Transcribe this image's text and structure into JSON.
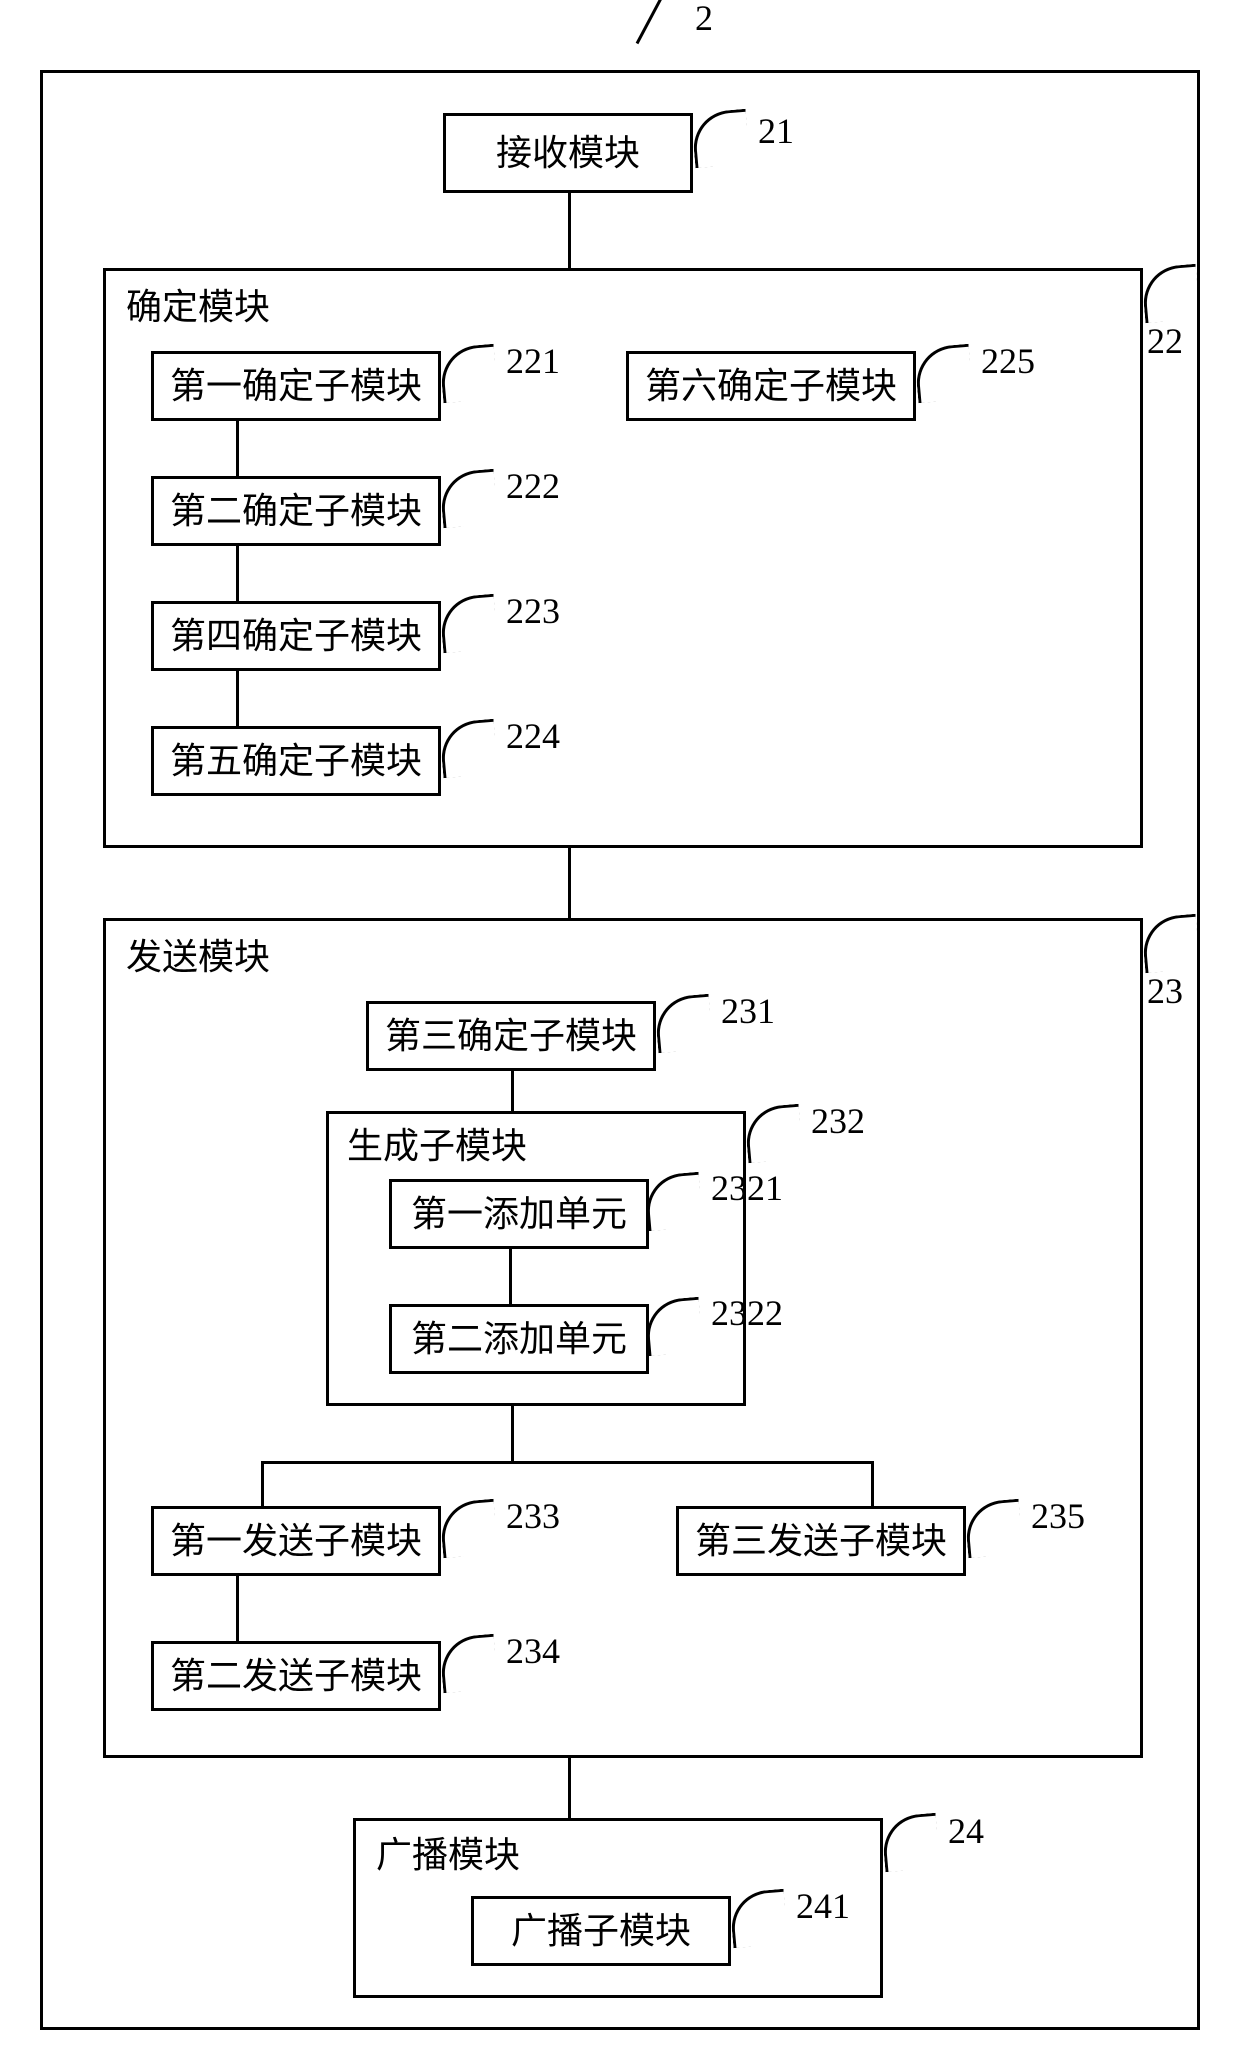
{
  "root": {
    "num": "2"
  },
  "receive": {
    "label": "接收模块",
    "num": "21"
  },
  "determine": {
    "title": "确定模块",
    "num": "22",
    "s1": {
      "label": "第一确定子模块",
      "num": "221"
    },
    "s2": {
      "label": "第二确定子模块",
      "num": "222"
    },
    "s4": {
      "label": "第四确定子模块",
      "num": "223"
    },
    "s5": {
      "label": "第五确定子模块",
      "num": "224"
    },
    "s6": {
      "label": "第六确定子模块",
      "num": "225"
    }
  },
  "send": {
    "title": "发送模块",
    "num": "23",
    "s3": {
      "label": "第三确定子模块",
      "num": "231"
    },
    "gen": {
      "title": "生成子模块",
      "num": "232",
      "u1": {
        "label": "第一添加单元",
        "num": "2321"
      },
      "u2": {
        "label": "第二添加单元",
        "num": "2322"
      }
    },
    "send1": {
      "label": "第一发送子模块",
      "num": "233"
    },
    "send2": {
      "label": "第二发送子模块",
      "num": "234"
    },
    "send3": {
      "label": "第三发送子模块",
      "num": "235"
    }
  },
  "broadcast": {
    "title": "广播模块",
    "num": "24",
    "sub": {
      "label": "广播子模块",
      "num": "241"
    }
  }
}
